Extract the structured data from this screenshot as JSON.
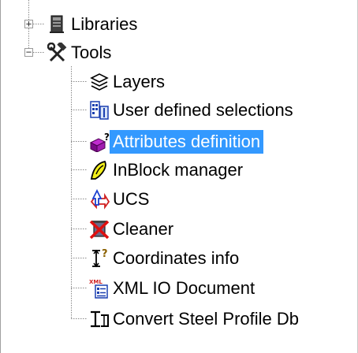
{
  "tree": {
    "libraries": {
      "label": "Libraries",
      "icon": "libraries-book-icon",
      "expander": "+"
    },
    "tools": {
      "label": "Tools",
      "icon": "tools-hammer-wrench-icon",
      "expander": "−",
      "children": [
        {
          "label": "Layers",
          "icon": "layers-icon"
        },
        {
          "label": "User defined selections",
          "icon": "user-selections-icon"
        },
        {
          "label": "Attributes definition",
          "icon": "attributes-definition-icon",
          "selected": true
        },
        {
          "label": "InBlock manager",
          "icon": "inblock-manager-icon"
        },
        {
          "label": "UCS",
          "icon": "ucs-icon"
        },
        {
          "label": "Cleaner",
          "icon": "cleaner-icon"
        },
        {
          "label": "Coordinates info",
          "icon": "coordinates-info-icon"
        },
        {
          "label": "XML IO Document",
          "icon": "xml-document-icon"
        },
        {
          "label": "Convert Steel Profile Db",
          "icon": "convert-steel-profile-icon"
        }
      ]
    }
  },
  "colors": {
    "selection": "#3399ff",
    "selection_text": "#ffffff"
  }
}
